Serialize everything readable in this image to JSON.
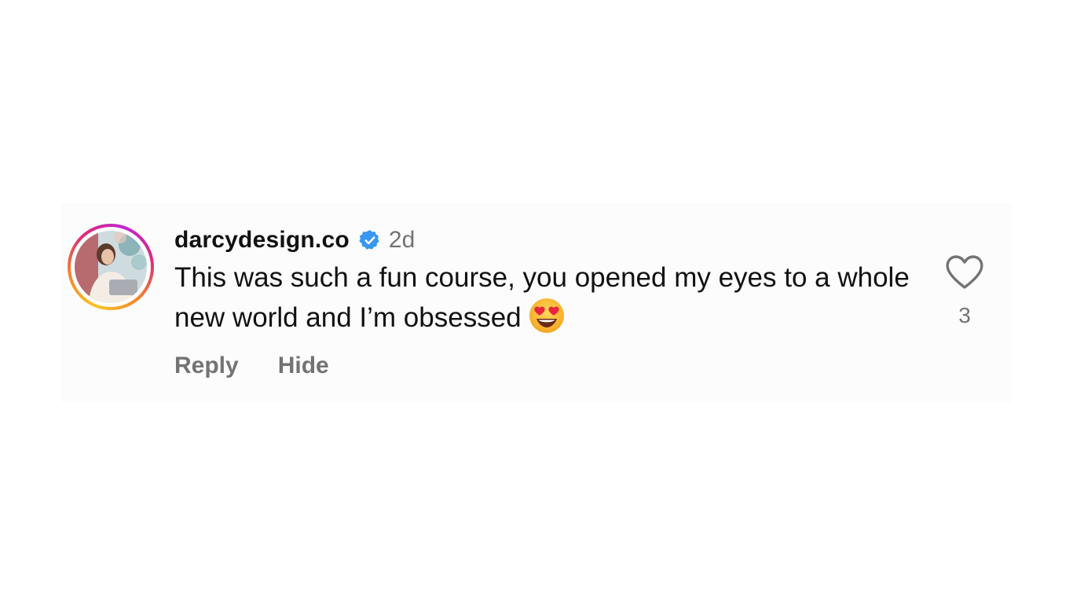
{
  "comment": {
    "username": "darcydesign.co",
    "verified_icon": "verified-badge-icon",
    "timestamp": "2d",
    "text": "This was such a fun course, you opened my eyes to a whole new world and I’m obsessed",
    "emoji_icon": "heart-eyes-emoji-icon",
    "actions": {
      "reply_label": "Reply",
      "hide_label": "Hide"
    },
    "like": {
      "icon": "heart-outline-icon",
      "count": "3"
    }
  },
  "colors": {
    "verified_blue": "#3897f0",
    "secondary_text": "#737373",
    "story_ring_start": "#f9c52a",
    "story_ring_end": "#c026d3"
  }
}
